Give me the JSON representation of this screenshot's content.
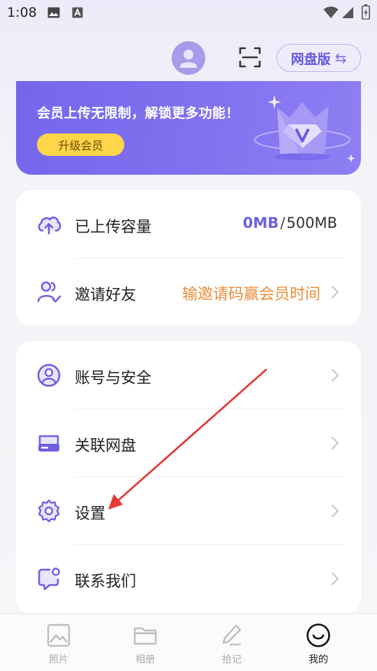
{
  "status_bar": {
    "time": "1:08"
  },
  "header": {
    "netdisk_label": "网盘版",
    "swap_glyph": "⇆"
  },
  "banner": {
    "text": "会员上传无限制，解锁更多功能！",
    "upgrade_label": "升级会员"
  },
  "storage_card": {
    "upload_label": "已上传容量",
    "used": "0MB",
    "separator": "/",
    "total": "500MB",
    "invite_label": "邀请好友",
    "invite_hint": "输邀请码赢会员时间"
  },
  "menu": [
    {
      "label": "账号与安全",
      "icon": "user-circle-icon"
    },
    {
      "label": "关联网盘",
      "icon": "drive-icon"
    },
    {
      "label": "设置",
      "icon": "gear-icon"
    },
    {
      "label": "联系我们",
      "icon": "chat-icon"
    }
  ],
  "tabs": [
    {
      "label": "照片",
      "icon": "photo-icon",
      "active": false
    },
    {
      "label": "相册",
      "icon": "folder-icon",
      "active": false
    },
    {
      "label": "拾记",
      "icon": "pen-icon",
      "active": false
    },
    {
      "label": "我的",
      "icon": "smile-icon",
      "active": true
    }
  ],
  "colors": {
    "accent": "#6d5fe2",
    "banner": "#7466ec",
    "upgrade": "#ffd54a",
    "hint": "#ea8d3a",
    "annotation": "#e53935"
  }
}
